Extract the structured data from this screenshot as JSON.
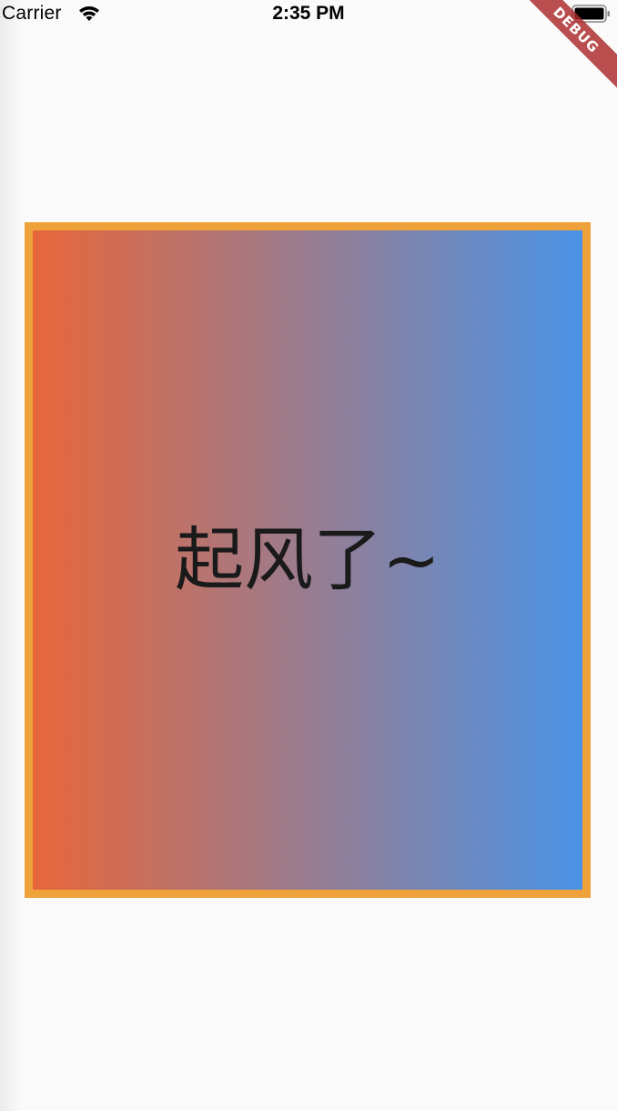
{
  "status_bar": {
    "carrier": "Carrier",
    "time": "2:35 PM",
    "wifi_icon": "wifi-icon",
    "battery_icon": "battery-icon"
  },
  "debug_banner": {
    "label": "DEBUG",
    "color": "#b02a2a"
  },
  "main": {
    "text": "起风了~",
    "gradient_start": "#e8663a",
    "gradient_end": "#4a93e6",
    "border_color": "#f0a23a",
    "background": "#fafafa"
  }
}
